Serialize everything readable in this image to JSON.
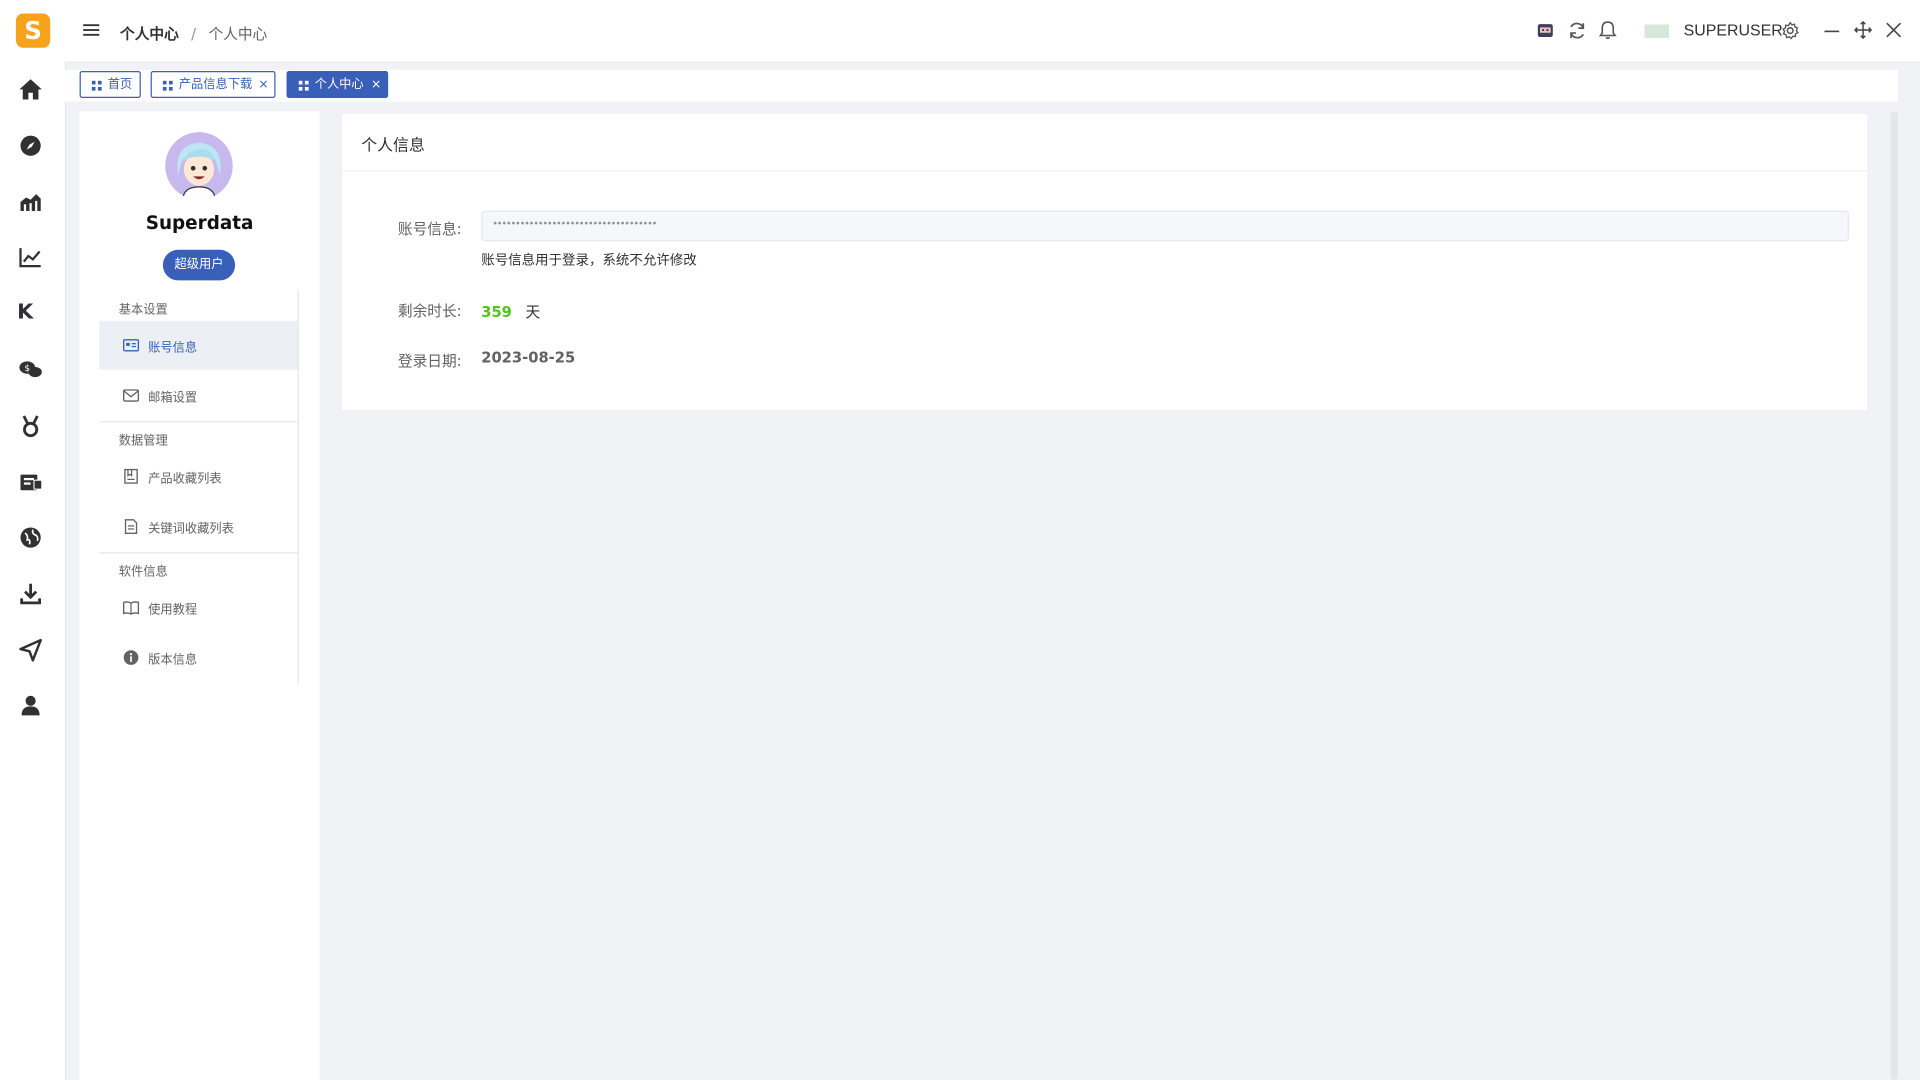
{
  "app": {
    "logo_letter": "S",
    "brand_color": "#f7a21b",
    "accent_color": "#3a5fb8"
  },
  "sidebar": {
    "icons": [
      "home-icon",
      "compass-icon",
      "chart-bars-icon",
      "line-chart-icon",
      "k-letter-icon",
      "chat-bubbles-icon",
      "medal-icon",
      "message-box-icon",
      "globe-icon",
      "download-icon",
      "send-icon",
      "user-icon"
    ],
    "k_letter": "K"
  },
  "header": {
    "breadcrumb": [
      "个人中心",
      "个人中心"
    ],
    "breadcrumb_sep": "/",
    "username": "SUPERUSER"
  },
  "tabs": [
    {
      "label": "首页",
      "closable": false,
      "active": false
    },
    {
      "label": "产品信息下载",
      "closable": true,
      "active": false
    },
    {
      "label": "个人中心",
      "closable": true,
      "active": true
    }
  ],
  "tab_close_glyph": "×",
  "profile": {
    "name": "Superdata",
    "role_badge": "超级用户",
    "sections": [
      {
        "title": "基本设置",
        "items": [
          {
            "label": "账号信息",
            "icon": "id-card-icon",
            "active": true
          },
          {
            "label": "邮箱设置",
            "icon": "mail-icon",
            "active": false
          }
        ]
      },
      {
        "title": "数据管理",
        "items": [
          {
            "label": "产品收藏列表",
            "icon": "bookmark-icon",
            "active": false
          },
          {
            "label": "关键词收藏列表",
            "icon": "document-icon",
            "active": false
          }
        ]
      },
      {
        "title": "软件信息",
        "items": [
          {
            "label": "使用教程",
            "icon": "book-icon",
            "active": false
          },
          {
            "label": "版本信息",
            "icon": "info-icon",
            "active": false
          }
        ]
      }
    ]
  },
  "main": {
    "card_title": "个人信息",
    "fields": {
      "account_label": "账号信息:",
      "account_value": "••••••••••••••••••••••••••••••••••••",
      "account_hint": "账号信息用于登录，系统不允许修改",
      "remaining_label": "剩余时长:",
      "remaining_days": "359",
      "remaining_unit": "天",
      "login_label": "登录日期:",
      "login_date": "2023-08-25"
    },
    "days_color": "#52c41a"
  }
}
